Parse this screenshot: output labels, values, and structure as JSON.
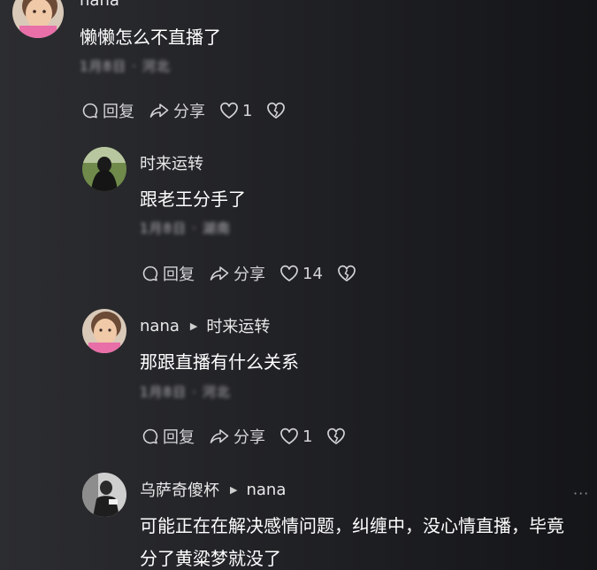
{
  "comments": [
    {
      "username": "nana",
      "text": "懒懒怎么不直播了",
      "meta_date": "1月8日",
      "meta_location": "河北",
      "reply_label": "回复",
      "share_label": "分享",
      "like_count": "1",
      "avatar": "child-avatar"
    },
    {
      "username": "时来运转",
      "text": "跟老王分手了",
      "meta_date": "1月8日",
      "meta_location": "湖南",
      "reply_label": "回复",
      "share_label": "分享",
      "like_count": "14",
      "avatar": "woman-back-avatar"
    },
    {
      "username": "nana",
      "reply_to": "时来运转",
      "text": "那跟直播有什么关系",
      "meta_date": "1月8日",
      "meta_location": "河北",
      "reply_label": "回复",
      "share_label": "分享",
      "like_count": "1",
      "avatar": "child-avatar"
    },
    {
      "username": "乌萨奇傻杯",
      "reply_to": "nana",
      "text_line1": "可能正在在解决感情问题，纠缠中，没心情直播，毕竟",
      "text_line2": "分了黄粱梦就没了",
      "avatar": "bw-figure-avatar"
    }
  ],
  "colors": {
    "accent_text": "#ffffff",
    "meta": "#b9b9bd",
    "background": "#1c1d21"
  }
}
